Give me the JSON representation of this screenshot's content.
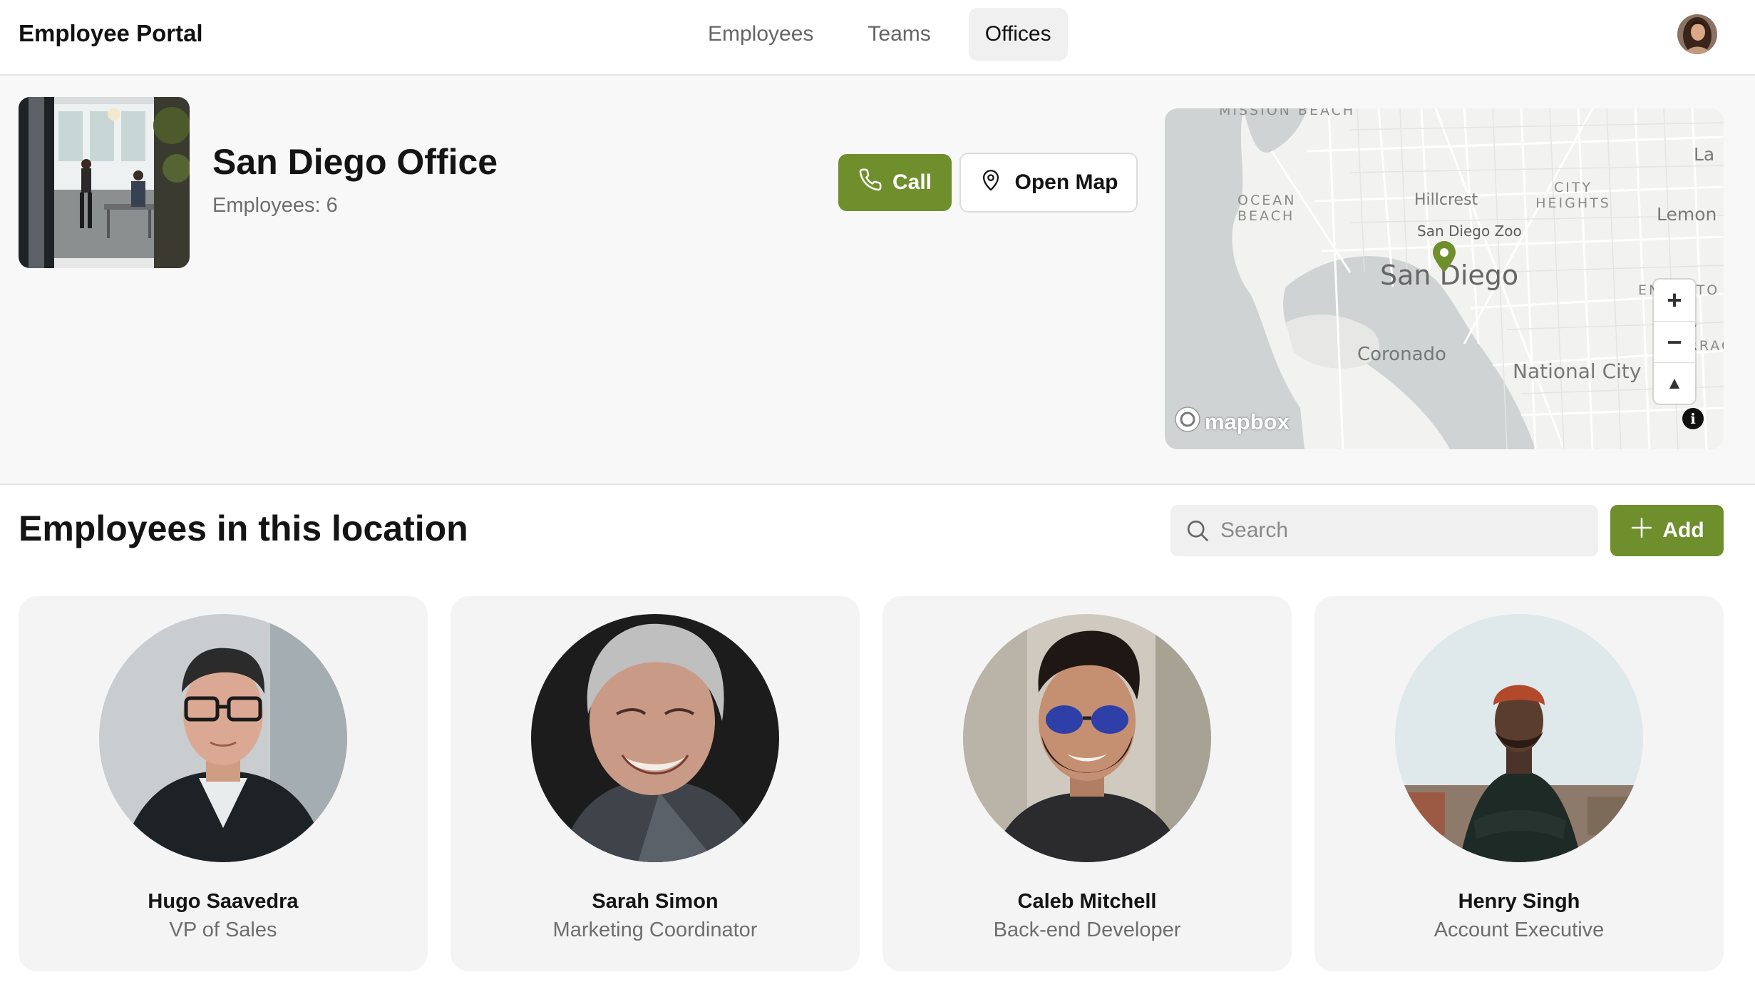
{
  "header": {
    "app_title": "Employee Portal",
    "nav": [
      {
        "label": "Employees",
        "active": false
      },
      {
        "label": "Teams",
        "active": false
      },
      {
        "label": "Offices",
        "active": true
      }
    ]
  },
  "office": {
    "name": "San Diego Office",
    "employees_count_text": "Employees: 6",
    "call_label": "Call",
    "open_map_label": "Open Map"
  },
  "map": {
    "labels": {
      "mission_beach": "MISSION BEACH",
      "ocean_beach": "OCEAN BEACH",
      "hillcrest": "Hillcrest",
      "city_heights": "CITY HEIGHTS",
      "la": "La",
      "lemon": "Lemon",
      "san_diego_zoo": "San Diego Zoo",
      "san_diego": "San Diego",
      "coronado": "Coronado",
      "national_city": "National City",
      "encanto": "ENCANTO",
      "bay_terraces": "BAY TERRACES"
    },
    "zoom_in": "+",
    "zoom_out": "−",
    "compass": "▲",
    "attribution_logo": "mapbox",
    "info": "i",
    "pin_color": "#6f8f2d"
  },
  "employees_section": {
    "heading": "Employees in this location",
    "search_placeholder": "Search",
    "add_label": "Add"
  },
  "employees": [
    {
      "name": "Hugo Saavedra",
      "role": "VP of Sales"
    },
    {
      "name": "Sarah Simon",
      "role": "Marketing Coordinator"
    },
    {
      "name": "Caleb Mitchell",
      "role": "Back-end Developer"
    },
    {
      "name": "Henry Singh",
      "role": "Account Executive"
    }
  ],
  "colors": {
    "accent": "#6f8f2d",
    "page_bg": "#f8f8f8",
    "card_bg": "#f4f4f4",
    "muted_text": "#6e6e6e"
  }
}
